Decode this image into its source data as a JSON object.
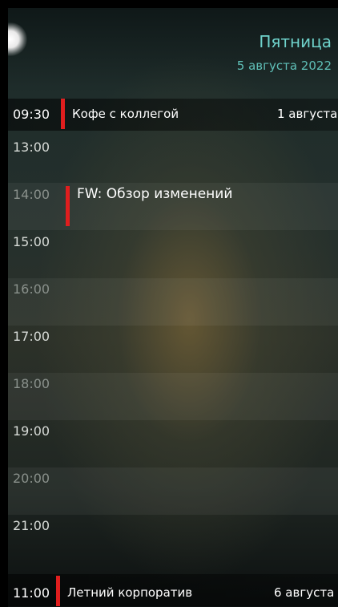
{
  "header": {
    "weekday": "Пятница",
    "date": "5 августа 2022"
  },
  "top_reminder": {
    "time": "09:30",
    "title": "Кофе с коллегой",
    "date": "1 августа"
  },
  "hours": [
    "13:00",
    "14:00",
    "15:00",
    "16:00",
    "17:00",
    "18:00",
    "19:00",
    "20:00",
    "21:00"
  ],
  "event": {
    "title": "FW: Обзор изменений"
  },
  "bottom_reminder": {
    "time": "11:00",
    "title": "Летний корпоратив",
    "date": "6 августа"
  },
  "colors": {
    "accent": "#6fd3cc",
    "event_bar": "#e01e1e"
  }
}
